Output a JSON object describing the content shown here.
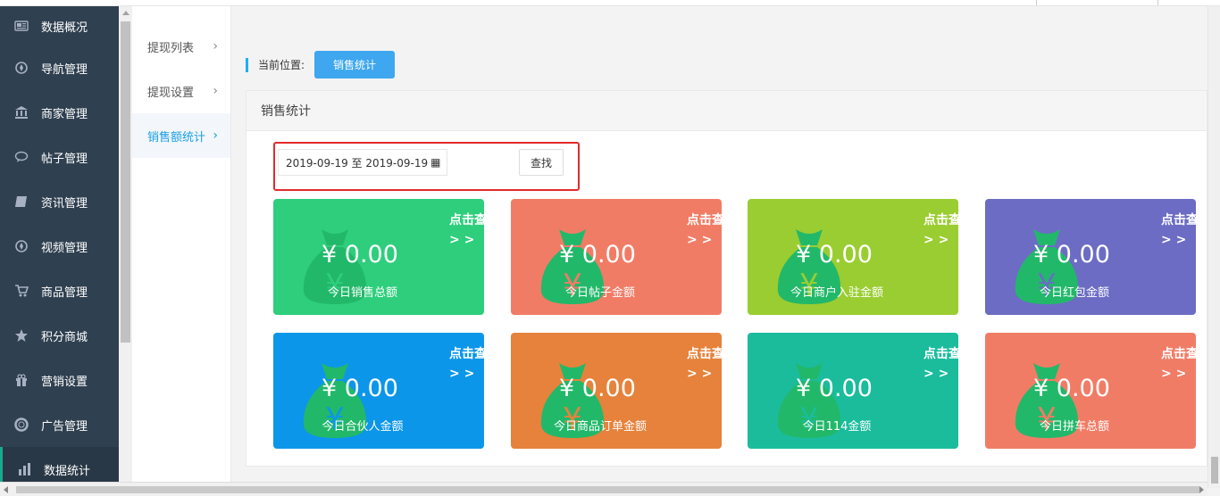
{
  "sidebar": {
    "items": [
      {
        "label": "数据概况",
        "icon": "newspaper-icon"
      },
      {
        "label": "导航管理",
        "icon": "compass-icon"
      },
      {
        "label": "商家管理",
        "icon": "bank-icon"
      },
      {
        "label": "帖子管理",
        "icon": "comment-icon"
      },
      {
        "label": "资讯管理",
        "icon": "book-icon"
      },
      {
        "label": "视频管理",
        "icon": "compass-icon"
      },
      {
        "label": "商品管理",
        "icon": "cart-icon"
      },
      {
        "label": "积分商城",
        "icon": "star-icon"
      },
      {
        "label": "营销设置",
        "icon": "gift-icon"
      },
      {
        "label": "广告管理",
        "icon": "lifebuoy-icon"
      },
      {
        "label": "数据统计",
        "icon": "chart-icon"
      }
    ]
  },
  "subnav": {
    "items": [
      {
        "label": "提现列表",
        "chevron": "›"
      },
      {
        "label": "提现设置",
        "chevron": "›"
      },
      {
        "label": "销售额统计",
        "chevron": "›"
      }
    ]
  },
  "breadcrumb": {
    "label": "当前位置:",
    "current": "销售统计"
  },
  "panel": {
    "title": "销售统计"
  },
  "filter": {
    "date_range": "2019-09-19 至 2019-09-19",
    "calendar_glyph": "▦",
    "search_label": "查找"
  },
  "cards": [
    {
      "amount": "¥ 0.00",
      "label": "今日销售总额",
      "more": "点击查",
      "arrow": "> >",
      "color": "#2ece7c"
    },
    {
      "amount": "¥ 0.00",
      "label": "今日帖子金额",
      "more": "点击查",
      "arrow": "> >",
      "color": "#f17c66"
    },
    {
      "amount": "¥ 0.00",
      "label": "今日商户入驻金额",
      "more": "点击查",
      "arrow": "> >",
      "color": "#9acd31"
    },
    {
      "amount": "¥ 0.00",
      "label": "今日红包金额",
      "more": "点击查",
      "arrow": "> >",
      "color": "#6c6cc4"
    },
    {
      "amount": "¥ 0.00",
      "label": "今日合伙人金额",
      "more": "点击查",
      "arrow": "> >",
      "color": "#0b96ea"
    },
    {
      "amount": "¥ 0.00",
      "label": "今日商品订单金额",
      "more": "点击查",
      "arrow": "> >",
      "color": "#e6823b"
    },
    {
      "amount": "¥ 0.00",
      "label": "今日114金额",
      "more": "点击查",
      "arrow": "> >",
      "color": "#1abc9c"
    },
    {
      "amount": "¥ 0.00",
      "label": "今日拼车总额",
      "more": "点击查",
      "arrow": "> >",
      "color": "#f17c66"
    }
  ],
  "colors": {
    "sidebar_bg": "#2f4050",
    "accent_blue": "#3ea7ef",
    "bag_green": "#22b86a"
  }
}
